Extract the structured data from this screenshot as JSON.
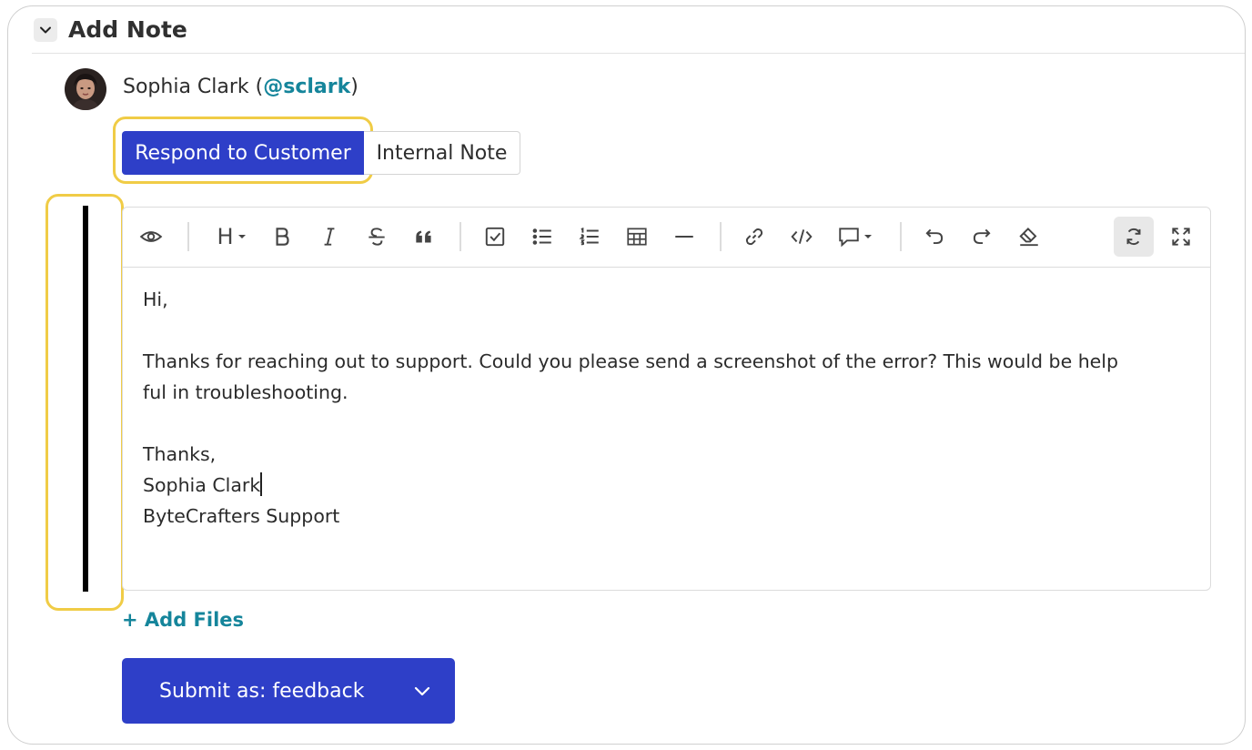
{
  "section": {
    "title": "Add Note"
  },
  "author": {
    "name": "Sophia Clark",
    "open_paren": " (",
    "handle": "@sclark",
    "close_paren": ")"
  },
  "tabs": {
    "respond": "Respond to Customer",
    "internal": "Internal Note"
  },
  "toolbar": {
    "heading": "H"
  },
  "editor": {
    "lines": [
      "Hi,",
      "",
      "Thanks for reaching out to support. Could you please send a screenshot of the error? This would be help",
      "ful in troubleshooting.",
      "",
      "Thanks,",
      "Sophia Clark",
      "ByteCrafters Support"
    ]
  },
  "actions": {
    "add_files": "+ Add Files",
    "submit": "Submit as: feedback"
  },
  "colors": {
    "primary": "#2e3fc8",
    "link": "#15859b",
    "focus_ring": "#f0cc46"
  }
}
